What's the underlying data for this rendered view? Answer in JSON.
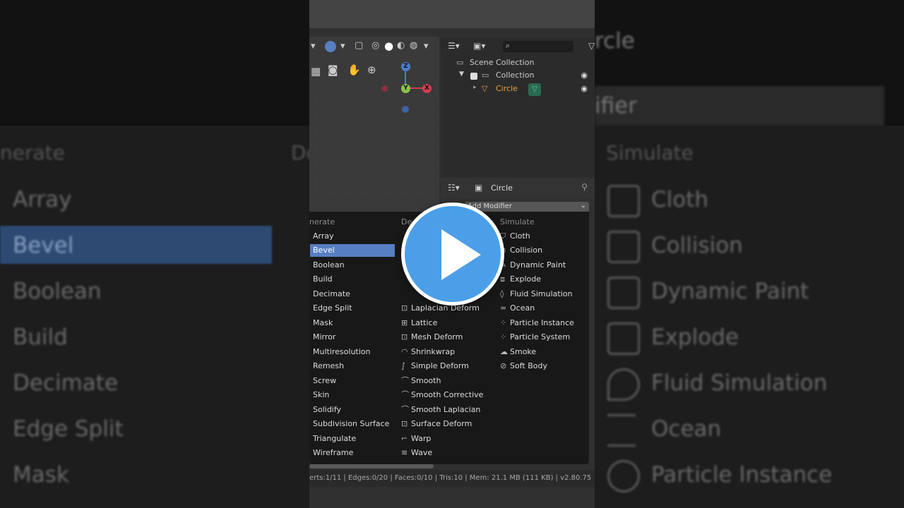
{
  "app": {
    "object_name": "Circle",
    "status": "erts:1/11 | Edges:0/20 | Faces:0/10 | Tris:10 | Mem: 21.1 MB (111 KB) | v2.80.75"
  },
  "outliner": {
    "scene_collection": "Scene Collection",
    "collection": "Collection",
    "object": "Circle"
  },
  "properties": {
    "object_label": "Circle",
    "add_modifier": "Add Modifier"
  },
  "gizmo": {
    "z": "Z",
    "y": "Y",
    "x": "X"
  },
  "modifier_menu": {
    "generate": {
      "heading": "nerate",
      "items": [
        "Array",
        "Bevel",
        "Boolean",
        "Build",
        "Decimate",
        "Edge Split",
        "Mask",
        "Mirror",
        "Multiresolution",
        "Remesh",
        "Screw",
        "Skin",
        "Solidify",
        "Subdivision Surface",
        "Triangulate",
        "Wireframe"
      ],
      "selected": "Bevel"
    },
    "deform": {
      "heading": "De",
      "items": [
        "Laplacian Deform",
        "Lattice",
        "Mesh Deform",
        "Shrinkwrap",
        "Simple Deform",
        "Smooth",
        "Smooth Corrective",
        "Smooth Laplacian",
        "Surface Deform",
        "Warp",
        "Wave"
      ]
    },
    "simulate": {
      "heading": "Simulate",
      "items": [
        "Cloth",
        "Collision",
        "Dynamic Paint",
        "Explode",
        "Fluid Simulation",
        "Ocean",
        "Particle Instance",
        "Particle System",
        "Smoke",
        "Soft Body"
      ]
    }
  },
  "background": {
    "left_heading": "nerate",
    "left_items": [
      "Array",
      "Bevel",
      "Boolean",
      "Build",
      "Decimate",
      "Edge Split",
      "Mask"
    ],
    "mid_heading": "De",
    "right_title": "rcle",
    "right_bar": "ifier",
    "right_heading": "Simulate",
    "right_items": [
      "Cloth",
      "Collision",
      "Dynamic Paint",
      "Explode",
      "Fluid Simulation",
      "Ocean",
      "Particle Instance"
    ]
  },
  "colors": {
    "selection": "#5680c2",
    "play_button": "#4a9fe8",
    "object_orange": "#e8a040"
  },
  "icons": {
    "play": "play-icon",
    "eye": "eye-icon",
    "pin": "pin-icon"
  }
}
